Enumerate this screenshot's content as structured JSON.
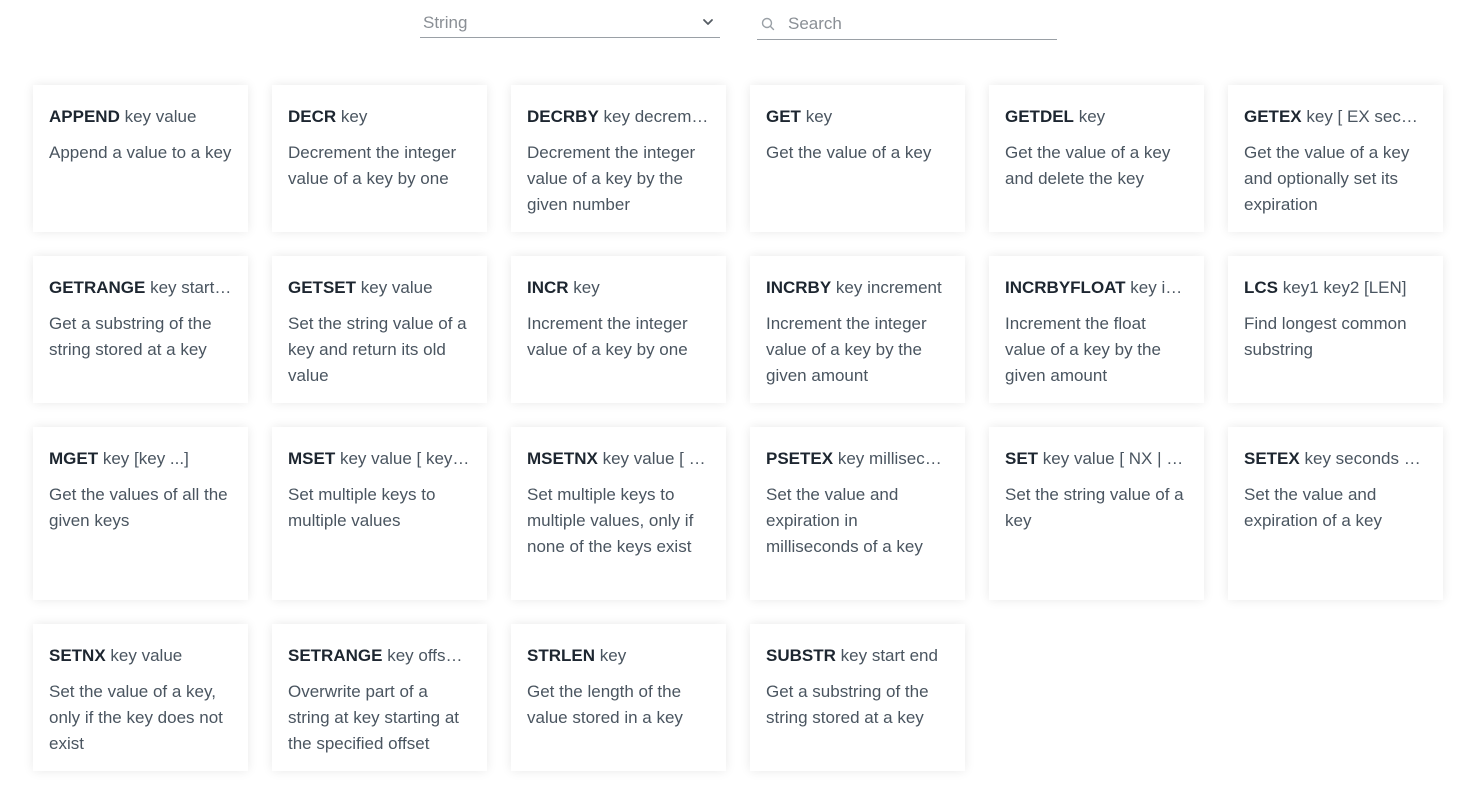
{
  "filter": {
    "selected": "String"
  },
  "search": {
    "placeholder": "Search"
  },
  "commands": [
    {
      "name": "APPEND",
      "args": "key value",
      "summary": "Append a value to a key"
    },
    {
      "name": "DECR",
      "args": "key",
      "summary": "Decrement the integer value of a key by one"
    },
    {
      "name": "DECRBY",
      "args": "key decrement",
      "summary": "Decrement the integer value of a key by the given number"
    },
    {
      "name": "GET",
      "args": "key",
      "summary": "Get the value of a key"
    },
    {
      "name": "GETDEL",
      "args": "key",
      "summary": "Get the value of a key and delete the key"
    },
    {
      "name": "GETEX",
      "args": "key [ EX seconds ]",
      "summary": "Get the value of a key and optionally set its expiration"
    },
    {
      "name": "GETRANGE",
      "args": "key start end",
      "summary": "Get a substring of the string stored at a key"
    },
    {
      "name": "GETSET",
      "args": "key value",
      "summary": "Set the string value of a key and return its old value"
    },
    {
      "name": "INCR",
      "args": "key",
      "summary": "Increment the integer value of a key by one"
    },
    {
      "name": "INCRBY",
      "args": "key increment",
      "summary": "Increment the integer value of a key by the given amount"
    },
    {
      "name": "INCRBYFLOAT",
      "args": "key increment",
      "summary": "Increment the float value of a key by the given amount"
    },
    {
      "name": "LCS",
      "args": "key1 key2 [LEN]",
      "summary": "Find longest common substring"
    },
    {
      "name": "MGET",
      "args": "key [key ...]",
      "summary": "Get the values of all the given keys"
    },
    {
      "name": "MSET",
      "args": "key value [ key value ...]",
      "summary": "Set multiple keys to multiple values"
    },
    {
      "name": "MSETNX",
      "args": "key value [ key value ...]",
      "summary": "Set multiple keys to multiple values, only if none of the keys exist"
    },
    {
      "name": "PSETEX",
      "args": "key milliseconds value",
      "summary": "Set the value and expiration in milliseconds of a key"
    },
    {
      "name": "SET",
      "args": "key value [ NX | XX ]",
      "summary": "Set the string value of a key"
    },
    {
      "name": "SETEX",
      "args": "key seconds value",
      "summary": "Set the value and expiration of a key"
    },
    {
      "name": "SETNX",
      "args": "key value",
      "summary": "Set the value of a key, only if the key does not exist"
    },
    {
      "name": "SETRANGE",
      "args": "key offset value",
      "summary": "Overwrite part of a string at key starting at the specified offset"
    },
    {
      "name": "STRLEN",
      "args": "key",
      "summary": "Get the length of the value stored in a key"
    },
    {
      "name": "SUBSTR",
      "args": "key start end",
      "summary": "Get a substring of the string stored at a key"
    }
  ]
}
